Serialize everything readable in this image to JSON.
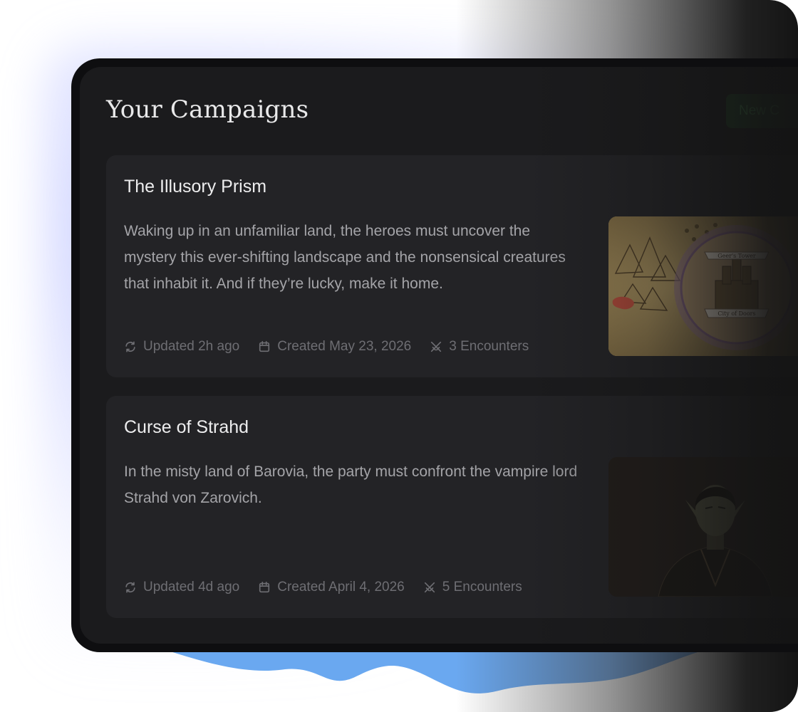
{
  "page": {
    "title": "Your Campaigns",
    "new_button_label": "New C"
  },
  "campaigns": [
    {
      "title": "The Illusory Prism",
      "description": "Waking up in an unfamiliar land, the heroes must uncover the mystery this ever-shifting landscape and the nonsensical creatures that inhabit it. And if they’re lucky, make it home.",
      "updated": "Updated 2h ago",
      "created": "Created May 23, 2026",
      "encounters": "3 Encounters",
      "image": "fantasy-map",
      "map_labels": [
        "Geer's Tower",
        "City of Doors"
      ]
    },
    {
      "title": "Curse of Strahd",
      "description": "In the misty land of Barovia, the party must confront the vampire lord Strahd von Zarovich.",
      "updated": "Updated 4d ago",
      "created": "Created April 4, 2026",
      "encounters": "5 Encounters",
      "image": "vampire-portrait"
    }
  ],
  "icons": {
    "updated": "refresh-icon",
    "created": "calendar-icon",
    "encounters": "crossed-swords-icon"
  },
  "colors": {
    "background": "#1b1b1d",
    "card": "#232326",
    "accent_green": "#1f3a24",
    "wave_blue": "#6aa8f0"
  }
}
